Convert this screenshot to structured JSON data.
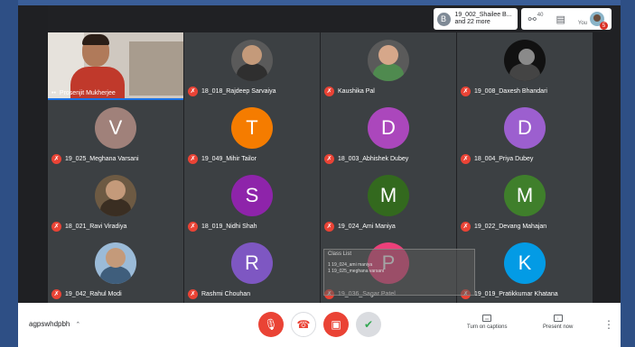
{
  "topbar": {
    "others_initial": "B",
    "others_line1": "19_002_Shailee B...",
    "others_line2": "and 22 more",
    "participants_count": "40",
    "you_label": "You",
    "you_badge": "5"
  },
  "participants": [
    {
      "name": "Prosenjit Mukherjee",
      "type": "video"
    },
    {
      "name": "18_018_Rajdeep Sarvaiya",
      "type": "photo"
    },
    {
      "name": "Kaushika Pal",
      "type": "photo"
    },
    {
      "name": "19_008_Daxesh Bhandari",
      "type": "photo"
    },
    {
      "name": "19_025_Meghana Varsani",
      "initial": "V",
      "color": "#a0817a"
    },
    {
      "name": "19_049_Mihir Tailor",
      "initial": "T",
      "color": "#f57c00"
    },
    {
      "name": "18_003_Abhishek Dubey",
      "initial": "D",
      "color": "#ab47bc"
    },
    {
      "name": "18_004_Priya Dubey",
      "initial": "D",
      "color": "#9c5fcf"
    },
    {
      "name": "18_021_Ravi Viradiya",
      "type": "photo"
    },
    {
      "name": "18_019_Nidhi Shah",
      "initial": "S",
      "color": "#8e24aa"
    },
    {
      "name": "19_024_Ami Maniya",
      "initial": "M",
      "color": "#33691e"
    },
    {
      "name": "19_022_Devang Mahajan",
      "initial": "M",
      "color": "#3f7f2b"
    },
    {
      "name": "19_042_Rahul Modi",
      "type": "photo"
    },
    {
      "name": "Rashmi Chouhan",
      "initial": "R",
      "color": "#7e57c2"
    },
    {
      "name": "19_036_Sagar Patel",
      "initial": "P",
      "color": "#ec407a"
    },
    {
      "name": "19_019_Pratikkumar Khatana",
      "initial": "K",
      "color": "#039be5"
    }
  ],
  "overlay": {
    "title": "Class List",
    "line1": "1 19_024_ami maniya",
    "line2": "1 19_025_meghana varsani"
  },
  "bottombar": {
    "meeting_code": "agpswhdpbh",
    "captions_label": "Turn on captions",
    "present_label": "Present now"
  },
  "icons": {
    "mic_off": "mic-off-icon",
    "end_call": "phone-hangup-icon",
    "camera_off": "camera-off-icon",
    "check": "check-icon"
  }
}
